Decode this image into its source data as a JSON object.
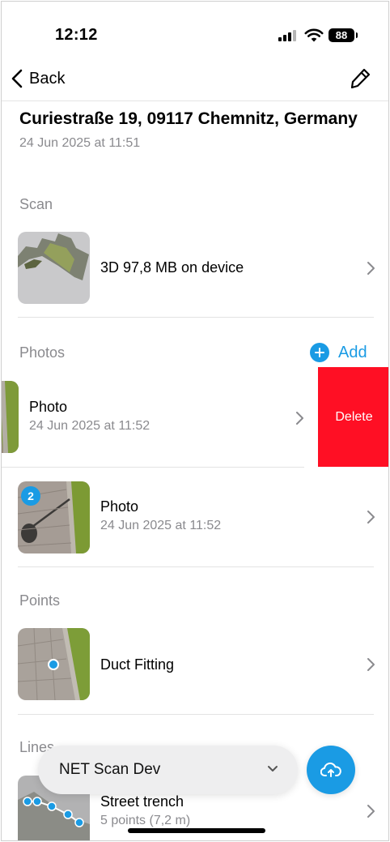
{
  "status_bar": {
    "time": "12:12",
    "battery": "88"
  },
  "nav": {
    "back_label": "Back",
    "edit_icon": "pencil-icon"
  },
  "header": {
    "title": "Curiestraße 19, 09117 Chemnitz, Germany",
    "date": "24 Jun 2025 at 11:51"
  },
  "scan": {
    "section_label": "Scan",
    "item": {
      "title": "3D 97,8 MB on device"
    }
  },
  "photos": {
    "section_label": "Photos",
    "add_label": "Add",
    "items": [
      {
        "title": "Photo",
        "subtitle": "24 Jun 2025 at 11:52",
        "delete_label": "Delete"
      },
      {
        "title": "Photo",
        "subtitle": "24 Jun 2025 at 11:52",
        "badge": "2"
      }
    ]
  },
  "points": {
    "section_label": "Points",
    "items": [
      {
        "title": "Duct Fitting"
      }
    ]
  },
  "lines": {
    "section_label": "Lines",
    "items": [
      {
        "title": "Street trench",
        "subtitle": "5 points (7,2 m)"
      }
    ]
  },
  "project_selector": {
    "label": "NET Scan Dev"
  },
  "upload_button": {
    "icon": "cloud-upload-icon"
  },
  "colors": {
    "accent": "#1a9be4",
    "destructive": "#ff0f24",
    "secondary_text": "#8a8a8e"
  }
}
